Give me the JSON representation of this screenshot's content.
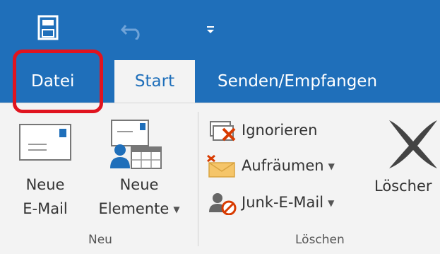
{
  "tabs": {
    "datei": "Datei",
    "start": "Start",
    "senden": "Senden/Empfangen"
  },
  "ribbon": {
    "neue_email": [
      "Neue",
      "E-Mail"
    ],
    "neue_elemente": [
      "Neue",
      "Elemente"
    ],
    "group_neu": "Neu",
    "ignorieren": "Ignorieren",
    "aufraeumen": "Aufräumen",
    "junk": "Junk-E-Mail",
    "loeschen_btn": "Löscher",
    "group_loeschen": "Löschen"
  },
  "icons": [
    "save-icon",
    "undo-icon",
    "customize-qat-icon",
    "new-email-icon",
    "new-items-icon",
    "ignore-icon",
    "cleanup-icon",
    "junk-icon",
    "delete-icon"
  ],
  "colors": {
    "accent": "#1f6fba",
    "highlight": "#e0141f"
  }
}
